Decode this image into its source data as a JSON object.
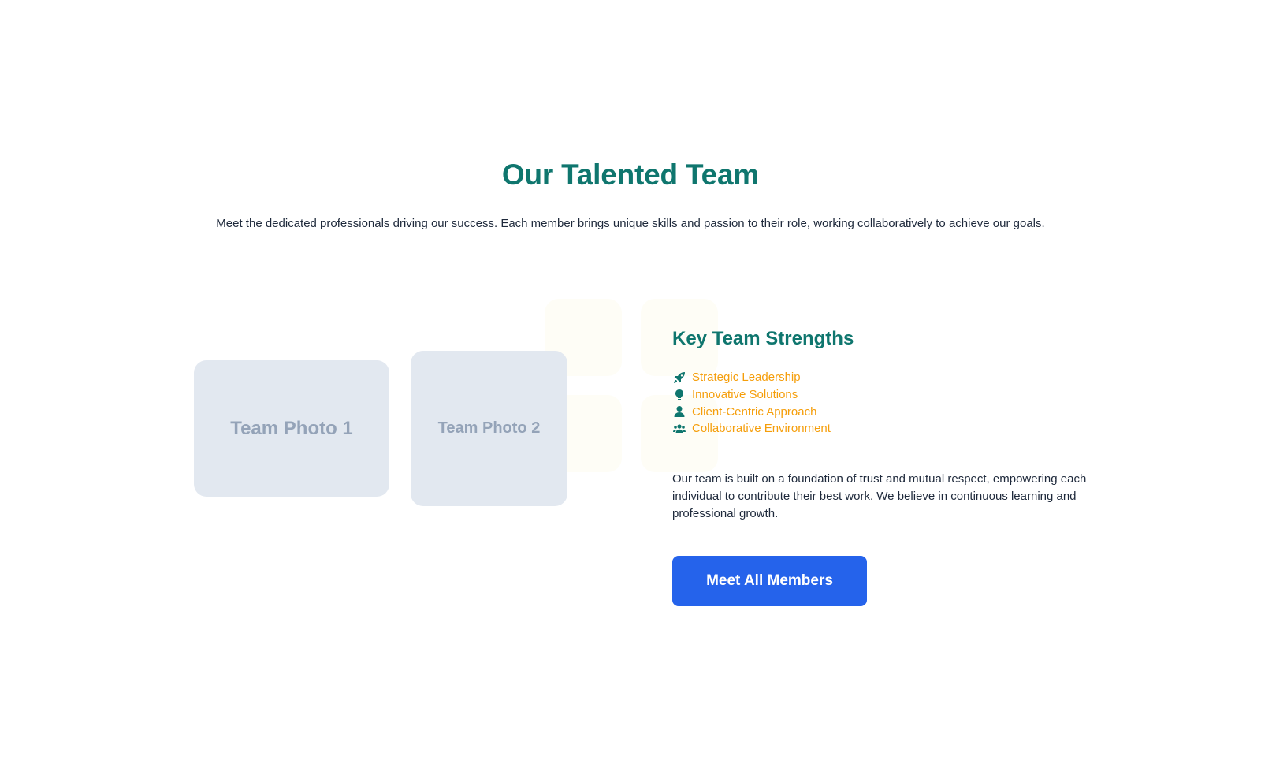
{
  "team_section": {
    "title": "Our Talented Team",
    "intro": "Meet the dedicated professionals driving our success. Each member brings unique skills and passion to their role, working collaboratively to achieve our goals.",
    "photos": [
      {
        "label": "Team Photo 1"
      },
      {
        "label": "Team Photo 2"
      }
    ],
    "strengths": {
      "title": "Key Team Strengths",
      "items": [
        {
          "label": "Strategic Leadership",
          "icon": "rocket-icon"
        },
        {
          "label": "Innovative Solutions",
          "icon": "lightbulb-icon"
        },
        {
          "label": "Client-Centric Approach",
          "icon": "user-icon"
        },
        {
          "label": "Collaborative Environment",
          "icon": "users-icon"
        }
      ]
    },
    "body": "Our team is built on a foundation of trust and mutual respect, empowering each individual to contribute their best work. We believe in continuous learning and professional growth.",
    "cta_label": "Meet All Members"
  },
  "colors": {
    "heading": "#0f766e",
    "accent": "#f59e0b",
    "button": "#2563eb",
    "placeholder_bg": "#e2e8f0",
    "placeholder_text": "#94a3b8"
  }
}
